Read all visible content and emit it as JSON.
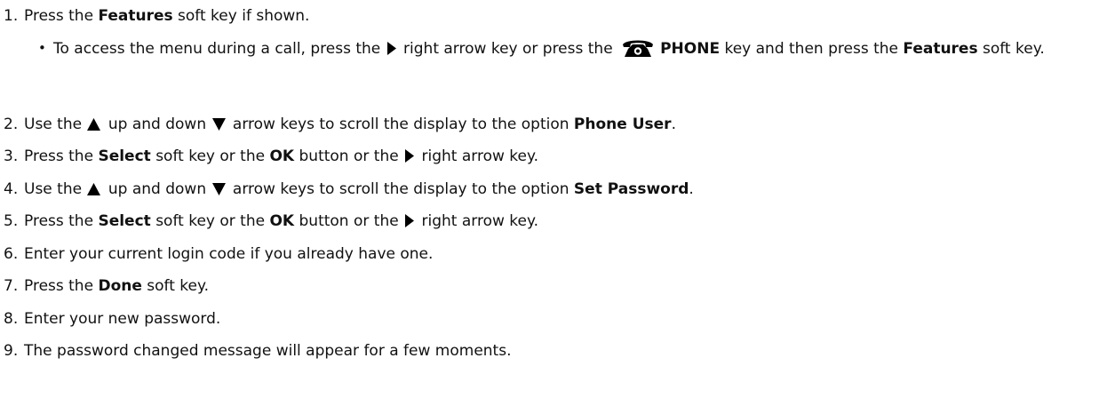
{
  "steps": [
    {
      "num": "1.",
      "a": "Press the ",
      "b1": "Features",
      "c": " soft key if shown."
    },
    {
      "num": "2.",
      "a": "Use the ",
      "b": " up and down ",
      "c": " arrow keys to scroll the display to the option ",
      "b1": "Phone User",
      "d": "."
    },
    {
      "num": "3.",
      "a": "Press the ",
      "b1": "Select",
      "c": " soft key or the ",
      "b2": "OK",
      "d": " button or the ",
      "e": " right arrow key."
    },
    {
      "num": "4.",
      "a": "Use the ",
      "b": " up and down ",
      "c": " arrow keys to scroll the display to the option ",
      "b1": "Set Password",
      "d": "."
    },
    {
      "num": "5.",
      "a": "Press the ",
      "b1": "Select",
      "c": " soft key or the ",
      "b2": "OK",
      "d": " button or the ",
      "e": " right arrow key."
    },
    {
      "num": "6.",
      "a": "Enter your current login code if you already have one."
    },
    {
      "num": "7.",
      "a": "Press the ",
      "b1": "Done",
      "c": " soft key."
    },
    {
      "num": "8.",
      "a": "Enter your new password."
    },
    {
      "num": "9.",
      "a": "The password changed message will appear for a few moments."
    }
  ],
  "step1_sub": {
    "bullet": "•",
    "a": "To access the menu during a call, press the ",
    "b": " right arrow key or press the ",
    "b1": "PHONE",
    "c": " key and then press the ",
    "b2": "Features",
    "d": " soft key."
  },
  "icons": {
    "right_arrow": "right-arrow-icon",
    "up_arrow": "up-arrow-icon",
    "down_arrow": "down-arrow-icon",
    "phone": "phone-icon"
  },
  "colors": {
    "text": "#111111",
    "background": "#ffffff",
    "icon": "#000000"
  }
}
